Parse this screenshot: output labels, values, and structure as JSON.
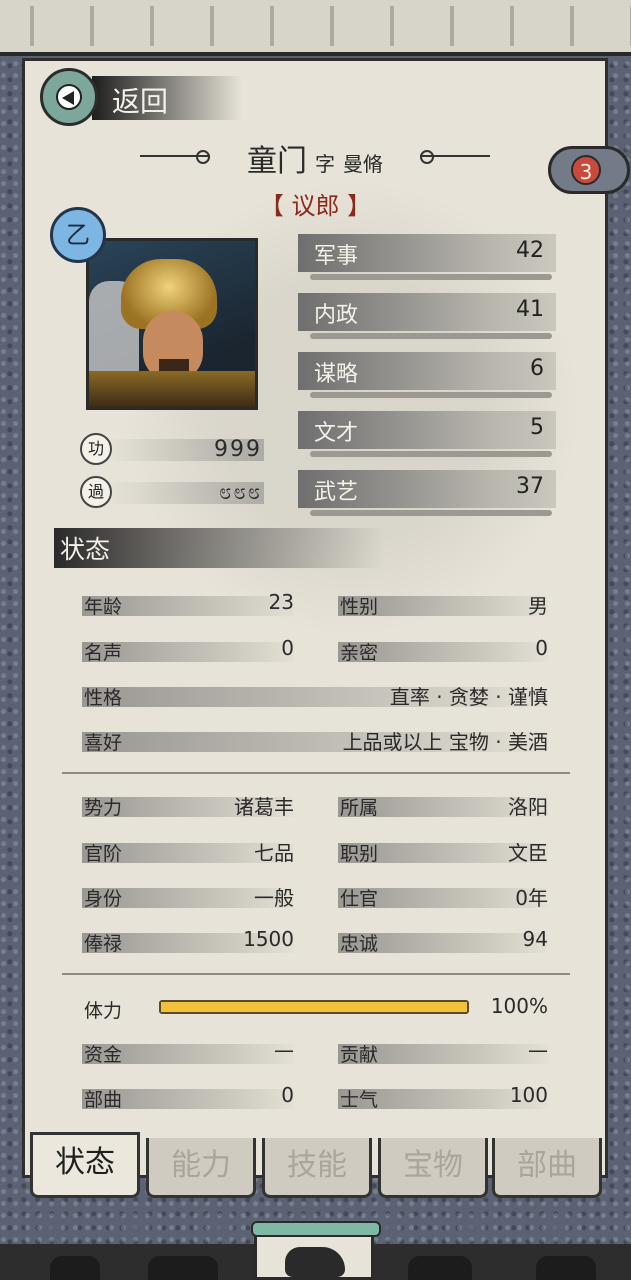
{
  "header": {
    "back_label": "返回"
  },
  "character": {
    "name": "童门",
    "style_label": "字",
    "style_name": "曼脩",
    "rank": "【 议郎 】",
    "grade": "乙",
    "notification_count": "3",
    "merit_seal": "功",
    "merit_value": "999",
    "demerit_seal": "過",
    "demerit_value": "೮೮೮"
  },
  "attributes": [
    {
      "name": "军事",
      "value": "42"
    },
    {
      "name": "内政",
      "value": "41"
    },
    {
      "name": "谋略",
      "value": "6"
    },
    {
      "name": "文才",
      "value": "5"
    },
    {
      "name": "武艺",
      "value": "37"
    }
  ],
  "status": {
    "section_title": "状态",
    "age": {
      "label": "年龄",
      "value": "23"
    },
    "gender": {
      "label": "性别",
      "value": "男"
    },
    "fame": {
      "label": "名声",
      "value": "0"
    },
    "intimacy": {
      "label": "亲密",
      "value": "0"
    },
    "personality": {
      "label": "性格",
      "value": "直率 · 贪婪 · 谨慎"
    },
    "hobby": {
      "label": "喜好",
      "value": "上品或以上 宝物 · 美酒"
    },
    "faction": {
      "label": "势力",
      "value": "诸葛丰"
    },
    "location": {
      "label": "所属",
      "value": "洛阳"
    },
    "official_rank": {
      "label": "官阶",
      "value": "七品"
    },
    "position": {
      "label": "职别",
      "value": "文臣"
    },
    "identity": {
      "label": "身份",
      "value": "一般"
    },
    "service": {
      "label": "仕官",
      "value": "0年"
    },
    "salary": {
      "label": "俸禄",
      "value": "1500"
    },
    "loyalty": {
      "label": "忠诚",
      "value": "94"
    },
    "stamina": {
      "label": "体力",
      "value": "100%",
      "fraction": 1.0
    },
    "funds": {
      "label": "资金",
      "value": "—"
    },
    "contribution": {
      "label": "贡献",
      "value": "—"
    },
    "troops": {
      "label": "部曲",
      "value": "0"
    },
    "morale": {
      "label": "士气",
      "value": "100"
    }
  },
  "tabs": [
    "状态",
    "能力",
    "技能",
    "宝物",
    "部曲"
  ],
  "colors": {
    "paper": "#e7e3d8",
    "accent_green": "#7da79a",
    "stamina_fill": "#f0c23c",
    "rank_red": "#8a2a1c"
  }
}
